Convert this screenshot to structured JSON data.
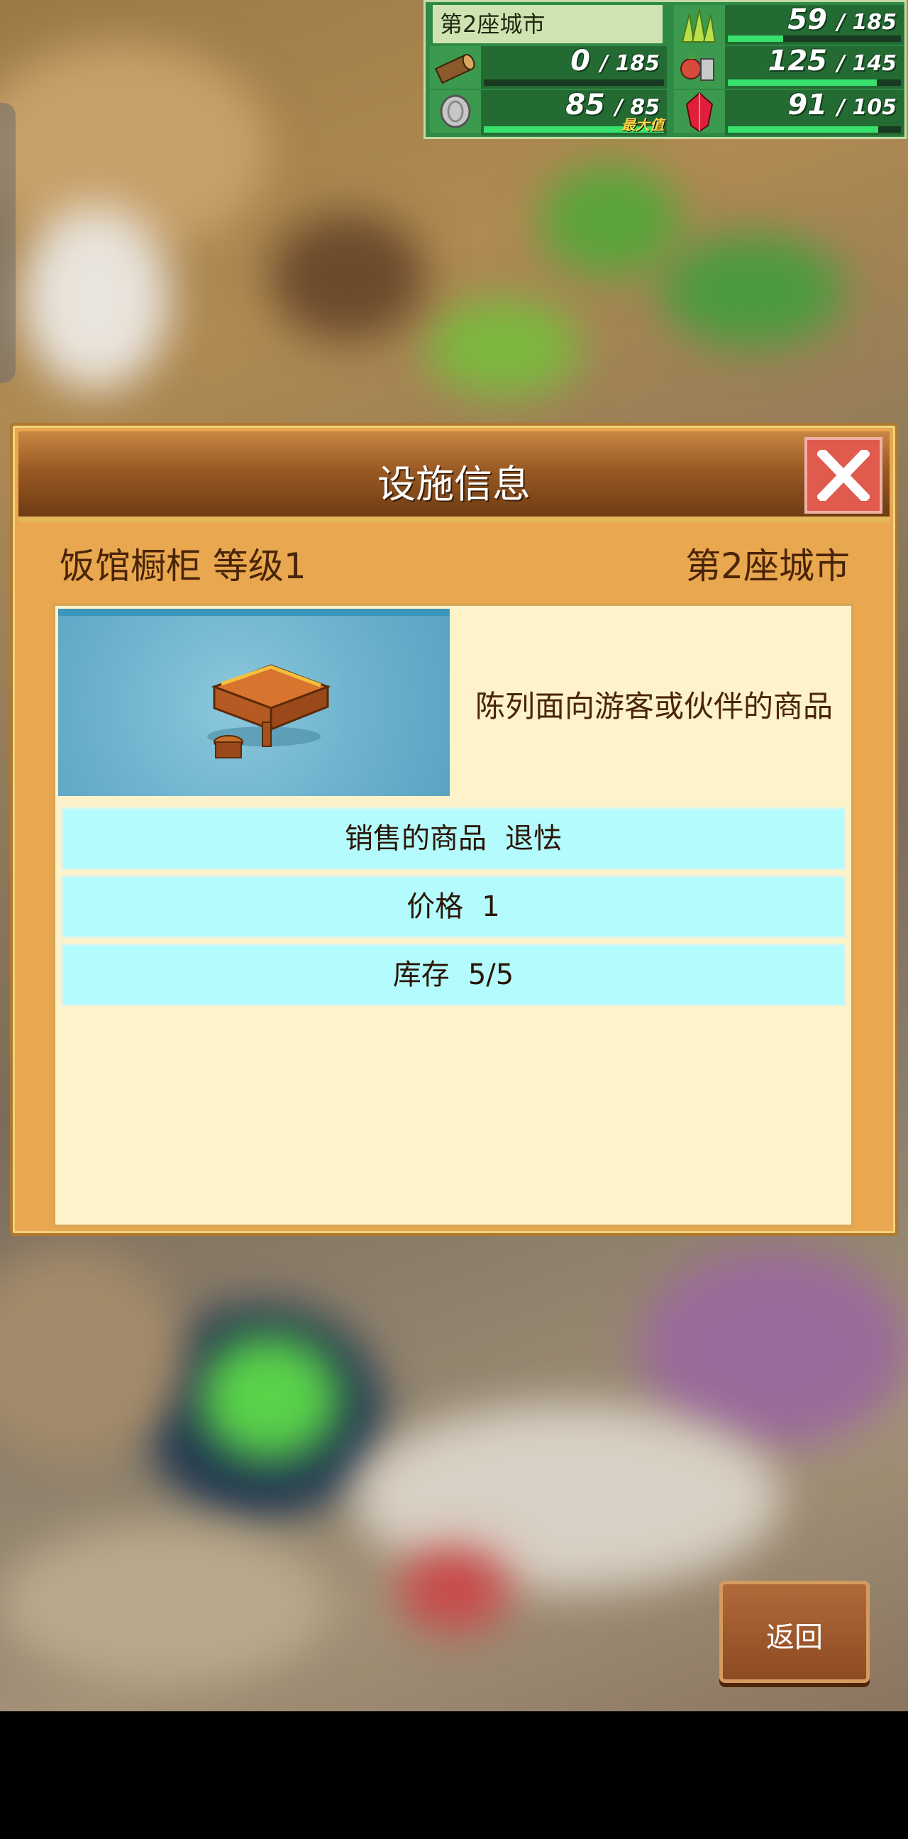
{
  "hud": {
    "city": "第2座城市",
    "resources": [
      {
        "icon": "grass-icon",
        "current": "59",
        "max": "185",
        "fill": 0.32
      },
      {
        "icon": "wood-log-icon",
        "current": "0",
        "max": "185",
        "fill": 0.0
      },
      {
        "icon": "vegetables-icon",
        "current": "125",
        "max": "145",
        "fill": 0.86
      },
      {
        "icon": "coin-icon",
        "current": "85",
        "max": "85",
        "fill": 1.0,
        "tag": "最大值"
      },
      {
        "icon": "red-gem-icon",
        "current": "91",
        "max": "105",
        "fill": 0.87
      }
    ],
    "separator": "/"
  },
  "dialog": {
    "title": "设施信息",
    "facility_name": "饭馆橱柜 等级1",
    "city_name": "第2座城市",
    "description": "陈列面向游客或伙伴的商品",
    "rows": [
      {
        "label": "销售的商品",
        "value": "退怯"
      },
      {
        "label": "价格",
        "value": "1"
      },
      {
        "label": "库存",
        "value": "5/5"
      }
    ]
  },
  "back_button": "返回",
  "colors": {
    "hud_green": "#2f8a45",
    "bar_fill": "#38e06c",
    "dialog_orange": "#e9a84f",
    "panel_cream": "#fdf2c9",
    "row_cyan": "#b4fbfd",
    "close_red": "#e05a4e"
  }
}
